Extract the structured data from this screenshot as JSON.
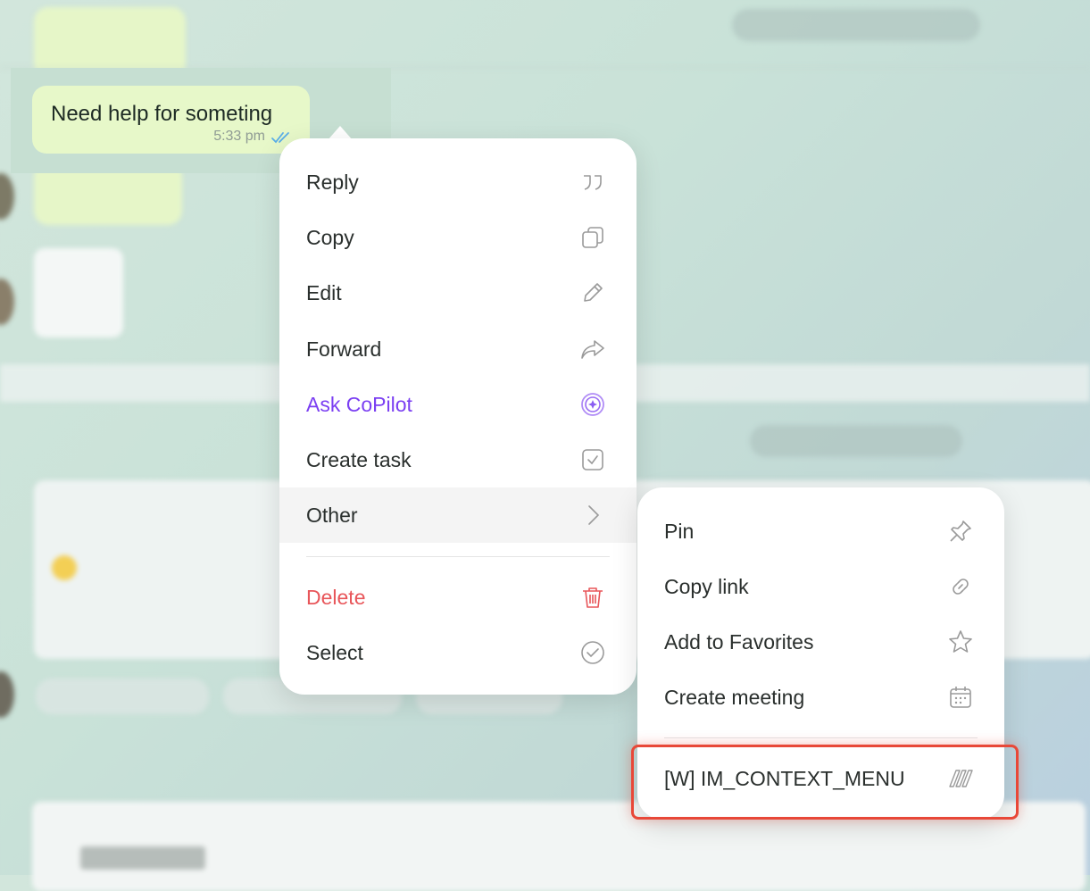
{
  "message": {
    "text": "Need help for someting",
    "time": "5:33 pm"
  },
  "context_menu": {
    "items": [
      {
        "label": "Reply",
        "icon": "quote-icon"
      },
      {
        "label": "Copy",
        "icon": "copy-icon"
      },
      {
        "label": "Edit",
        "icon": "pencil-icon"
      },
      {
        "label": "Forward",
        "icon": "forward-arrow-icon"
      },
      {
        "label": "Ask CoPilot",
        "icon": "copilot-icon",
        "color": "#7b3ff2"
      },
      {
        "label": "Create task",
        "icon": "checkbox-icon"
      },
      {
        "label": "Other",
        "icon": "chevron-right-icon",
        "active": true
      },
      {
        "label": "Delete",
        "icon": "trash-icon",
        "color": "#e8565a"
      },
      {
        "label": "Select",
        "icon": "check-circle-icon"
      }
    ]
  },
  "submenu": {
    "items": [
      {
        "label": "Pin",
        "icon": "pin-icon"
      },
      {
        "label": "Copy link",
        "icon": "link-icon"
      },
      {
        "label": "Add to Favorites",
        "icon": "star-icon"
      },
      {
        "label": "Create meeting",
        "icon": "calendar-icon"
      },
      {
        "label": "[W] IM_CONTEXT_MENU",
        "icon": "stripes-icon",
        "highlighted": true
      }
    ]
  },
  "colors": {
    "accent_purple": "#7b3ff2",
    "danger_red": "#e8565a",
    "highlight_border": "#e84838",
    "bubble_green": "#e7f8c9",
    "read_ticks": "#5aaee8"
  }
}
